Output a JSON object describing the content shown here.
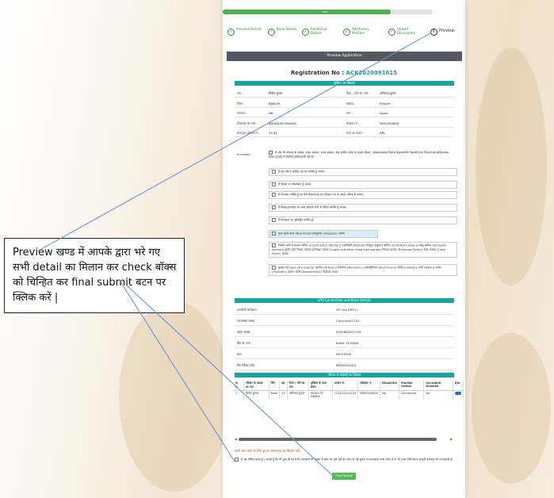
{
  "progress": {
    "percent": 80,
    "label": "80%"
  },
  "steps": [
    {
      "label": "Personal Details",
      "done": true
    },
    {
      "label": "Bank Details",
      "done": true
    },
    {
      "label": "Additional Details",
      "done": true
    },
    {
      "label": "Add Family Member",
      "done": true
    },
    {
      "label": "Upload Documents",
      "done": true
    },
    {
      "label": "Preview",
      "done": false,
      "number": "6"
    }
  ],
  "preview_header": "Preview Application",
  "registration": {
    "label": "Registration No :",
    "value": "ACK2020091615"
  },
  "personal_section_title": "मुखिया का विवरण",
  "personal_rows": [
    {
      "k": "नाम :",
      "v": "विनीत कुमार",
      "k2": "पिता / पति का नाम :",
      "v2": "अनिलाय कुमार"
    },
    {
      "k": "जिला :",
      "v": "RANCHI",
      "k2": "प्रखण्ड :",
      "v2": "Khelari"
    },
    {
      "k": "पंचायत :",
      "v": "NA",
      "k2": "ग्राम :",
      "v2": "Lapra"
    },
    {
      "k": "विधायक का नाम :",
      "v": "BAHADUR MUNDA",
      "k2": "मोबाइल नं :",
      "v2": "9855454645"
    },
    {
      "k": "प्रोफाइल प्रतिशत नं :",
      "v": "24.91",
      "k2": "कार्ड का प्रकार :",
      "v2": "APL"
    }
  ],
  "inclusion_label": "Inclusion",
  "inclusion_items": [
    "मैं और मेरे परिवार के सदस्य, भारत सरकार, राज्य सरकार, केंद्र शासित प्रदेश या इनके परिवार, उपक्रम/स्वायत्त निकाय केंद्र/स्थानीय निकायों/राज्य निगम/राज्य बोर्ड/स्वायत्त संस्था इत्यादि में नियमित/संविदाकर्मी नहीं है।",
    "मैं 60 वर्ष से अधिक उम्र का व्यक्ति हूँ अथवा,",
    "मैं विधवा या परित्यक्ता हूँ अथवा,",
    "मैं निःशक्त व्यक्ति हूँ एवं मेरी विकलांगता का प्रतिशत 40 या इससे अधिक है अथवा,",
    "मैं किन्नर/ट्रांसजेंडर या अन्य असाध्य रोगों से पीड़ित व्यक्ति हूँ अथवा,",
    "मैं निःसहाय या गृहविहीन व्यक्ति हूँ।",
    "कूड़ा चुनने वाला (Rag Picker)/झाड़ूकश (Sweeper) अथवा",
    "निर्माण कार्य में संलग्न श्रमिक (Construction Worker)/ राजमिस्त्री (Mason)/ मजदूर/ अकुशल श्रमिक (Unskilled Labour)/ घरेलू श्रमिक (Domestic Worker)/ कुली/ ठेला रिक्शा चालक/ ई-रिक्शा चालक (Coolie and other head load worker)/ रिक्शा चालक (Rickshaw Puller)/ ठेला चालक (Thela Puller) अथवा",
    "सुरक्षा गार्ड (Security Guard)/ कारीगर (Artisan)/ मैकेनिक (Mechanic)/ इलेक्ट्रीशियन (Electrician)/ मोची (Cobbler)/ दर्जी (Tailor)/ प्लंबर (Plumber)/ हमाल/ धोबी (Washerman)/ जोड़ीदार अथवा"
  ],
  "lpg_section_title": "LPG Connection and Bank Details",
  "lpg_rows": [
    {
      "k": "एलपीजी कनेक्शन",
      "v": "HP Gas (HPCL)"
    },
    {
      "k": "उपभोक्ता संख्या",
      "v": "Consumer1234"
    },
    {
      "k": "खाता संख्या",
      "v": "0000865007793"
    },
    {
      "k": "बैंक का नाम",
      "v": "BANK OF INDIA"
    },
    {
      "k": "ब्रांच",
      "v": "DEOGHAR"
    },
    {
      "k": "बैंक स्विफ्ट कोड",
      "v": "BKID0004401"
    }
  ],
  "family_section_title": "परिवार के सदस्यों का विवरण",
  "family_headers": [
    "क्र. सं.",
    "परिवार के सदस्य का नाम",
    "लिंग",
    "उम्र",
    "पिता / पति का नाम",
    "मुखिया के साथ संबंध",
    "आधार सं.",
    "मोबाइल नं.",
    "Disability",
    "Marital Status",
    "Incurable Disease",
    "Dis"
  ],
  "family_rows": [
    [
      "1",
      "विनीत कुमार",
      "Male",
      "29",
      "अनिलाय कुमार",
      "HEAD OF FAMILY",
      "123122122133",
      "9855454645",
      "No",
      "Unmarried",
      "No",
      ""
    ]
  ],
  "note": "फार्म जमा करने के लिए कृपया घोषणापत्र का मिलान करें।",
  "declaration": "मैं यह घोषित करता हूँ / करती हूँ कि मेरे द्वारा दी गई सभी जानकारी मेरे संज्ञान में सत्य एवं पूर्ण सही हैं। अगर दी गई सूचना गलत/असत्य पाया जाता है तो मेरे ऊपर विधि संगत कानूनी कार्रवाई की जा सकती है।",
  "submit_label": "Final Submit",
  "callout_text": "Preview खण्ड में आपके द्वारा भरे गए सभी detail का मिलान कर check बॉक्स को चिन्हित कर  final submit बटन पर क्लिक करें |"
}
